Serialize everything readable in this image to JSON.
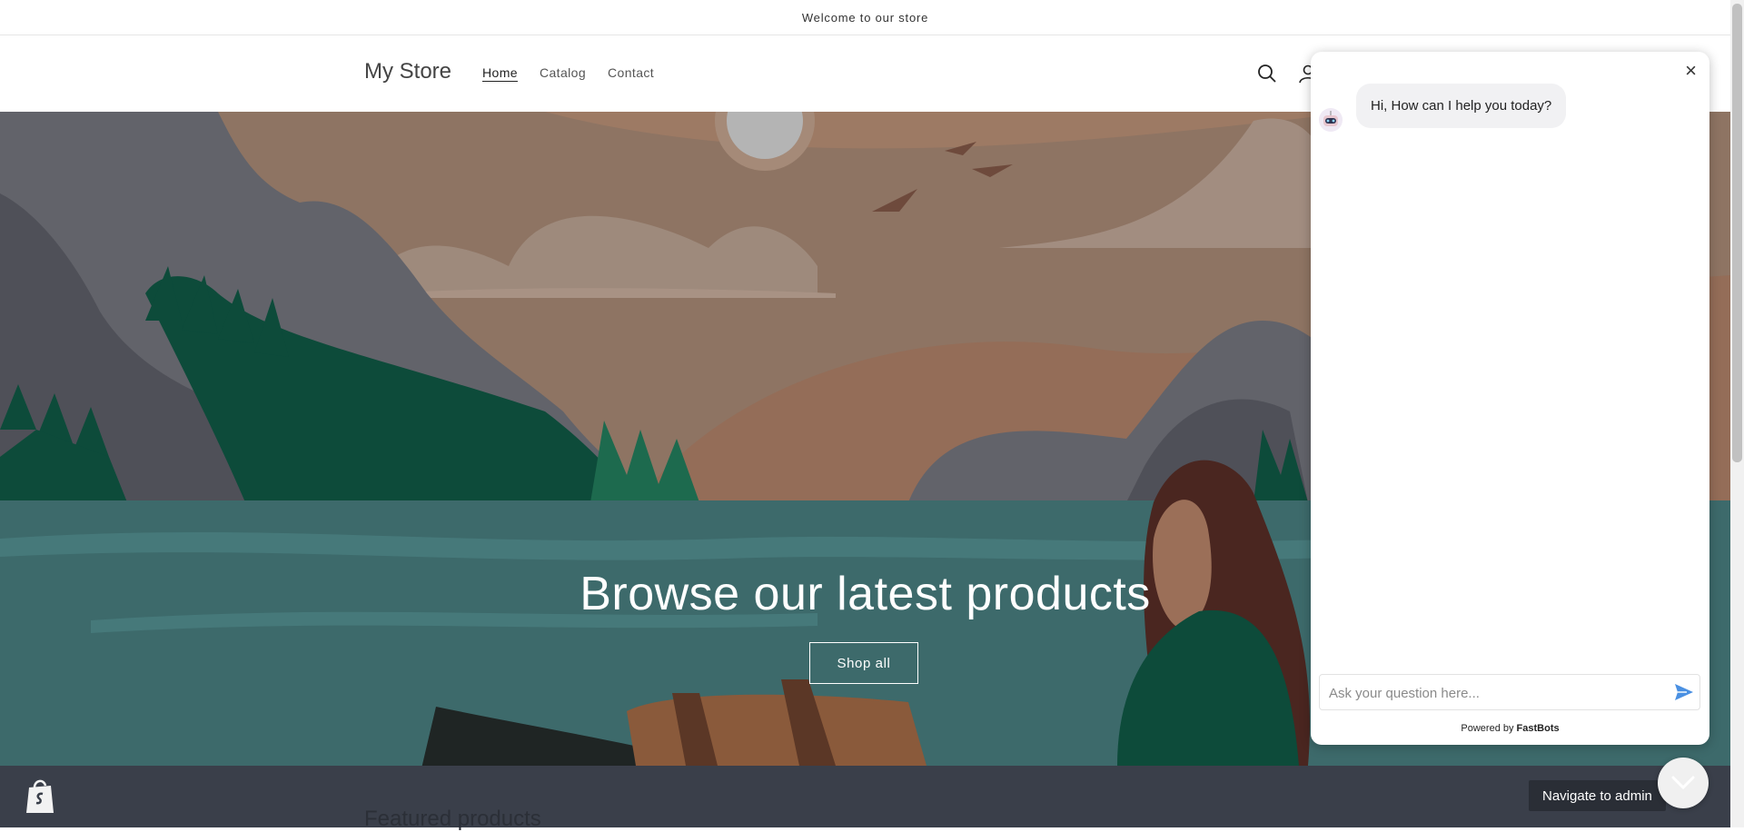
{
  "announcement": {
    "text": "Welcome to our store"
  },
  "header": {
    "logo": "My Store",
    "nav": [
      {
        "label": "Home",
        "active": true
      },
      {
        "label": "Catalog",
        "active": false
      },
      {
        "label": "Contact",
        "active": false
      }
    ],
    "icons": [
      "search-icon",
      "account-icon"
    ]
  },
  "hero": {
    "title": "Browse our latest products",
    "button": "Shop all"
  },
  "bottom": {
    "featured": "Featured products",
    "navigate_admin": "Navigate to admin"
  },
  "chat": {
    "close": "×",
    "greeting": "Hi, How can I help you today?",
    "input_placeholder": "Ask your question here...",
    "powered_prefix": "Powered by",
    "powered_brand": "FastBots"
  },
  "colors": {
    "sky": "#8d725f",
    "water": "#3d6a6b",
    "trees": "#0d4b3a",
    "bar": "#3a3f4a"
  }
}
